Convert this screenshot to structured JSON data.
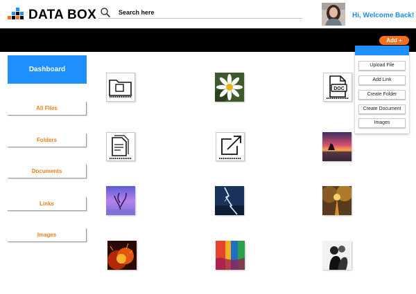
{
  "header": {
    "logo_text": "DATA BOX",
    "search_placeholder": "Search here",
    "welcome_text": "Hi, Welcome Back!"
  },
  "toolbar": {
    "add_label": "Add +"
  },
  "add_menu": {
    "items": [
      "Upload File",
      "Add Link",
      "Create Folder",
      "Create Document",
      "Images"
    ]
  },
  "sidebar": {
    "title": "Dashboard",
    "items": [
      "All Files",
      "Folders",
      "Documents",
      "Links",
      "Images"
    ]
  },
  "grid": {
    "tiles": [
      {
        "name": "folder-icon",
        "kind": "icon"
      },
      {
        "name": "daisy-thumbnail",
        "kind": "image"
      },
      {
        "name": "doc-file-icon",
        "kind": "icon"
      },
      {
        "name": "document-icon",
        "kind": "icon"
      },
      {
        "name": "external-link-icon",
        "kind": "icon"
      },
      {
        "name": "sunset-rock-thumbnail",
        "kind": "image"
      },
      {
        "name": "purple-tree-thumbnail",
        "kind": "image"
      },
      {
        "name": "lightning-thumbnail",
        "kind": "image"
      },
      {
        "name": "autumn-road-thumbnail",
        "kind": "image"
      },
      {
        "name": "lava-thumbnail",
        "kind": "image"
      },
      {
        "name": "colorful-abstract-thumbnail",
        "kind": "image"
      },
      {
        "name": "couple-bw-thumbnail",
        "kind": "image"
      }
    ]
  },
  "colors": {
    "accent_blue": "#1e90ff",
    "accent_orange": "#f36f21",
    "sidebar_text": "#ef7d1a",
    "welcome_text": "#1a8fe8"
  }
}
